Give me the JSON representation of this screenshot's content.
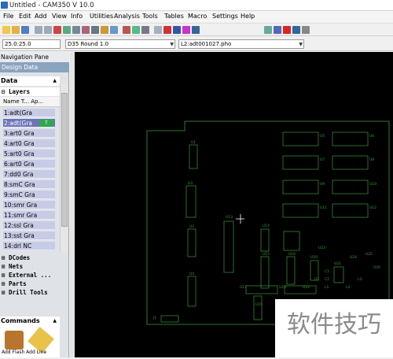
{
  "window": {
    "title": "Untitled - CAM350 V 10.0"
  },
  "menu": [
    "File",
    "Edit",
    "Add",
    "View",
    "Info",
    "Utilities",
    "Analysis",
    "Tools",
    "Tables",
    "Macro",
    "Settings",
    "Help"
  ],
  "combos": {
    "zoom": "25.0:25.0",
    "dcode": "D35  Round 1.0",
    "layer": "L2:adt001027.pho"
  },
  "nav": {
    "title": "Navigation Pane",
    "design_data": "Design Data",
    "data_section": "Data",
    "layers_label": "Layers",
    "columns": "Name T... Ap...",
    "layers": [
      "1:adt(Gra",
      "2:adt(Gra",
      "3:art0 Gra",
      "4:art0 Gra",
      "5:art0 Gra",
      "6:art0 Gra",
      "7:dd0 Gra",
      "8:smC Gra",
      "9:smC Gra",
      "10:smr Gra",
      "11:smr Gra",
      "12:ssl Gra",
      "13:sst Gra",
      "14:drl NC"
    ],
    "selected_badge": "T",
    "tree": [
      "DCodes",
      "Nets",
      "External ...",
      "Parts",
      "Drill Tools"
    ],
    "commands": "Commands",
    "command_labels": "Add Flash  Add Line"
  },
  "pcb": {
    "refdes": [
      "U1",
      "U3",
      "U2",
      "U4",
      "U5",
      "U6",
      "U7",
      "U8",
      "U9",
      "U10",
      "U11",
      "U12",
      "U13",
      "U14",
      "U15",
      "U16",
      "U17",
      "U18",
      "U19",
      "U20",
      "U21",
      "U22",
      "U23",
      "U24",
      "U25",
      "U26",
      "J1",
      "D1",
      "C1",
      "C2",
      "L1",
      "L2",
      "L3"
    ]
  },
  "watermark": "软件技巧"
}
